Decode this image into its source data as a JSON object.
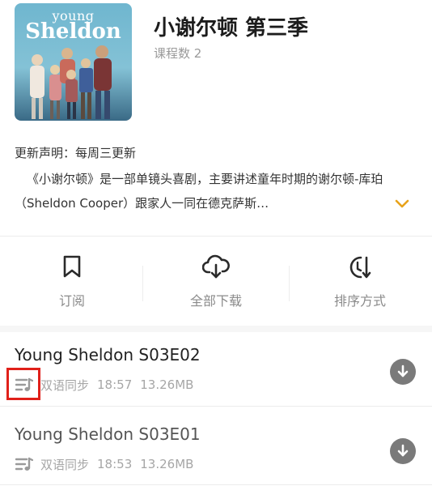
{
  "album": {
    "cover_line1": "young",
    "cover_line2": "Sheldon",
    "title": "小谢尔顿 第三季",
    "course_count": "课程数 2"
  },
  "description": {
    "update_note": "更新声明：每周三更新",
    "intro": "《小谢尔顿》是一部单镜头喜剧，主要讲述童年时期的谢尔顿-库珀（Sheldon Cooper）跟家人一同在德克萨斯…"
  },
  "actions": [
    {
      "label": "订阅",
      "icon": "bookmark-icon"
    },
    {
      "label": "全部下载",
      "icon": "cloud-download-icon"
    },
    {
      "label": "排序方式",
      "icon": "sort-icon"
    }
  ],
  "episodes": [
    {
      "title": "Young Sheldon S03E02",
      "sync": "双语同步",
      "duration": "18:57",
      "size": "13.26MB",
      "highlighted": true
    },
    {
      "title": "Young Sheldon S03E01",
      "sync": "双语同步",
      "duration": "18:53",
      "size": "13.26MB",
      "highlighted": false
    }
  ],
  "colors": {
    "accent_arrow": "#e8a31b",
    "highlight_box": "#e0201a",
    "download_button": "#7a7a7a"
  }
}
